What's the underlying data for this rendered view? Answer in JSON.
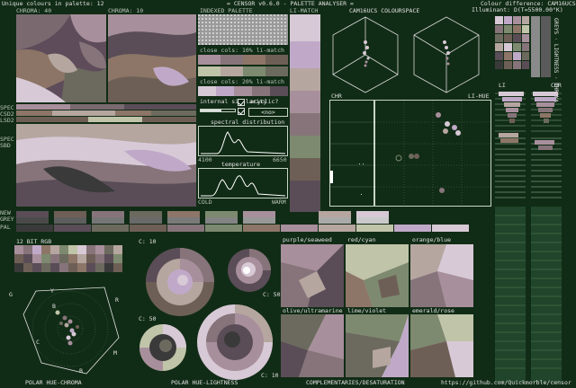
{
  "header": {
    "unique_colours": "Unique colours in palette: 12",
    "app_title": "= CENSOR v0.6.0 - PALETTE ANALYSER =",
    "colour_difference": "Colour difference: CAM16UCS",
    "illuminant": "Illuminant: D(T=5500.00°K)"
  },
  "sections": {
    "chroma_40": "CHROMA: 40",
    "chroma_10": "CHROMA: 10",
    "indexed_palette": "INDEXED PALETTE",
    "li_match": "LI-MATCH",
    "colourspace": "CAM16UCS COLOURSPACE",
    "chr_left": "CHR",
    "li_hue": "LI-HUE",
    "chr_right": "CHR",
    "li": "LI",
    "close_cols_10": "close cols: 10% li-match",
    "close_cols_20": "close cols: 20% li-match",
    "internal_similarity": "internal similarity",
    "acyclic": "acyclic?",
    "acyclic_value": "<no>",
    "spectral_distribution": "spectral distribution",
    "spectral_min": "4100",
    "spectral_max": "6650",
    "temperature": "temperature",
    "cold": "COLD",
    "warm": "WARM",
    "spec": "SPEC",
    "csd2": "CSD2",
    "lsd2": "LSD2",
    "spec2": "SPEC",
    "sbd": "SBD",
    "new": "NEW",
    "grey": "GREY",
    "pal": "PAL",
    "twelve_bit": "12 BIT RGB",
    "c10_a": "C: 10",
    "c50_a": "C: 50",
    "c50_b": "C: 50",
    "c10_b": "C: 10",
    "purple_seaweed": "purple/seaweed",
    "red_cyan": "red/cyan",
    "orange_blue": "orange/blue",
    "olive_ultramarine": "olive/ultramarine",
    "lime_violet": "lime/violet",
    "emerald_rose": "emerald/rose",
    "polar_hue_chroma": "POLAR HUE-CHROMA",
    "polar_hue_lightness": "POLAR HUE-LIGHTNESS",
    "complementaries": "COMPLEMENTARIES/DESATURATION",
    "github": "https://github.com/Quickmorble/censor",
    "side_label": "GREYS · LIGHTNESS · CHROMA",
    "axis_g": "G",
    "axis_b": "B",
    "axis_b2": "B",
    "axis_y": "Y",
    "axis_r": "R",
    "axis_c": "C",
    "axis_m": "M"
  },
  "palette": [
    "#3b3a3a",
    "#5a4d57",
    "#6c6a5e",
    "#6e5f56",
    "#86747a",
    "#7d8a6f",
    "#8d7667",
    "#a88f9c",
    "#b6a6a0",
    "#c0c4a9",
    "#c0a9c8",
    "#d7c9d5"
  ],
  "colors": {
    "background": "#112c16",
    "panel_dark": "#0b2410",
    "frame": "#c8d4c8",
    "curve": "#ffffff"
  }
}
